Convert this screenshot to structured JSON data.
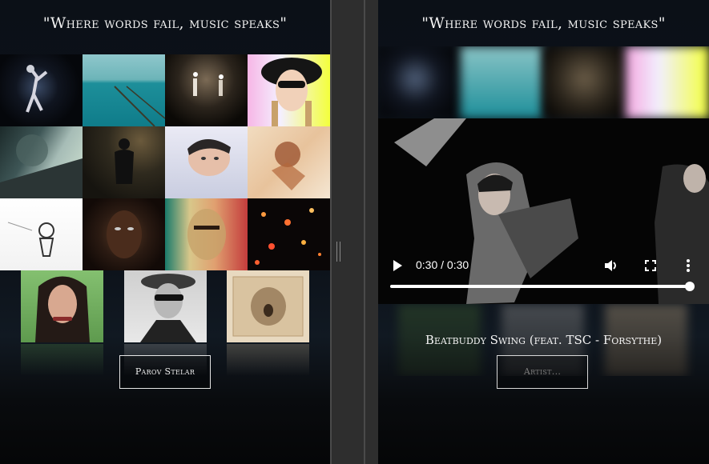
{
  "left": {
    "quote": "\"Where words fail, music speaks\"",
    "artist_button_label": "Parov Stelar",
    "grid_tiles": [
      {
        "name": "tile-dancer-dark"
      },
      {
        "name": "tile-sea-pier"
      },
      {
        "name": "tile-concert-stage"
      },
      {
        "name": "tile-hat-sunglasses"
      },
      {
        "name": "tile-train-smoke"
      },
      {
        "name": "tile-silhouette-man"
      },
      {
        "name": "tile-boy-pillow"
      },
      {
        "name": "tile-illustrated-figure"
      },
      {
        "name": "tile-sketch-drawing"
      },
      {
        "name": "tile-woman-portrait"
      },
      {
        "name": "tile-pop-art-face"
      },
      {
        "name": "tile-bokeh-lights"
      }
    ],
    "bottom_tiles": [
      {
        "name": "tile-woman-green-bg"
      },
      {
        "name": "tile-man-hat-bw"
      },
      {
        "name": "tile-vintage-card"
      }
    ]
  },
  "right": {
    "quote": "\"Where words fail, music speaks\"",
    "song_title": "Beatbuddy Swing (feat. TSC - Forsythe)",
    "artist_input_placeholder": "Artist...",
    "video": {
      "time_display": "0:30 / 0:30",
      "progress": 1.0
    }
  },
  "colors": {
    "background": "#0b1017",
    "divider": "#2e2e2e",
    "text": "#f2f2f2"
  },
  "icons": [
    "play-icon",
    "volume-icon",
    "fullscreen-icon",
    "more-options-icon",
    "divider-grip-icon"
  ]
}
